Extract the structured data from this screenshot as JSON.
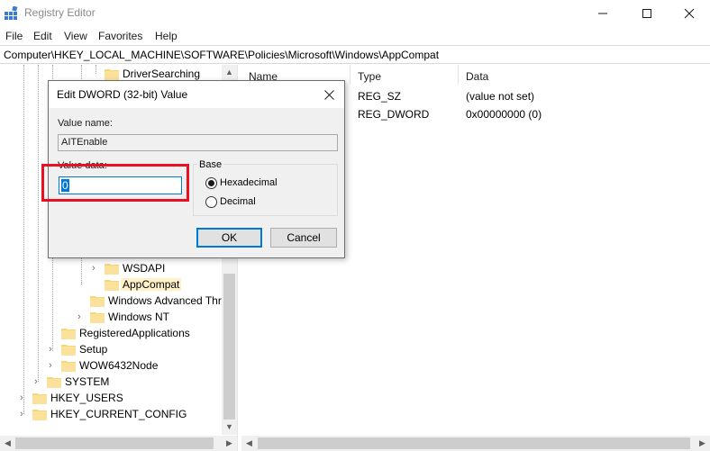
{
  "window": {
    "title": "Registry Editor"
  },
  "menu": [
    "File",
    "Edit",
    "View",
    "Favorites",
    "Help"
  ],
  "address": "Computer\\HKEY_LOCAL_MACHINE\\SOFTWARE\\Policies\\Microsoft\\Windows\\AppCompat",
  "tree": {
    "items": [
      {
        "label": "DriverSearching",
        "expandable": false
      },
      {
        "label": "WSDAPI",
        "expandable": true
      },
      {
        "label": "AppCompat",
        "expandable": false,
        "selected": true
      },
      {
        "label": "Windows Advanced Thr",
        "expandable": false
      },
      {
        "label": "Windows NT",
        "expandable": true
      },
      {
        "label": "RegisteredApplications",
        "expandable": false
      },
      {
        "label": "Setup",
        "expandable": true
      },
      {
        "label": "WOW6432Node",
        "expandable": true
      },
      {
        "label": "SYSTEM",
        "expandable": true
      },
      {
        "label": "HKEY_USERS",
        "expandable": true
      },
      {
        "label": "HKEY_CURRENT_CONFIG",
        "expandable": true
      }
    ]
  },
  "list": {
    "headers": {
      "name": "Name",
      "type": "Type",
      "data": "Data"
    },
    "rows": [
      {
        "type": "REG_SZ",
        "data": "(value not set)"
      },
      {
        "type": "REG_DWORD",
        "data": "0x00000000 (0)"
      }
    ]
  },
  "dialog": {
    "title": "Edit DWORD (32-bit) Value",
    "value_name_label": "Value name:",
    "value_name": "AITEnable",
    "value_data_label": "Value data:",
    "value_data": "0",
    "base_label": "Base",
    "base_options": [
      {
        "label": "Hexadecimal",
        "checked": true
      },
      {
        "label": "Decimal",
        "checked": false
      }
    ],
    "ok_label": "OK",
    "cancel_label": "Cancel"
  },
  "colors": {
    "accent": "#0078d7",
    "highlight_box": "#e81123",
    "selection_bg": "#fff1c6",
    "folder": "#f8d775"
  }
}
